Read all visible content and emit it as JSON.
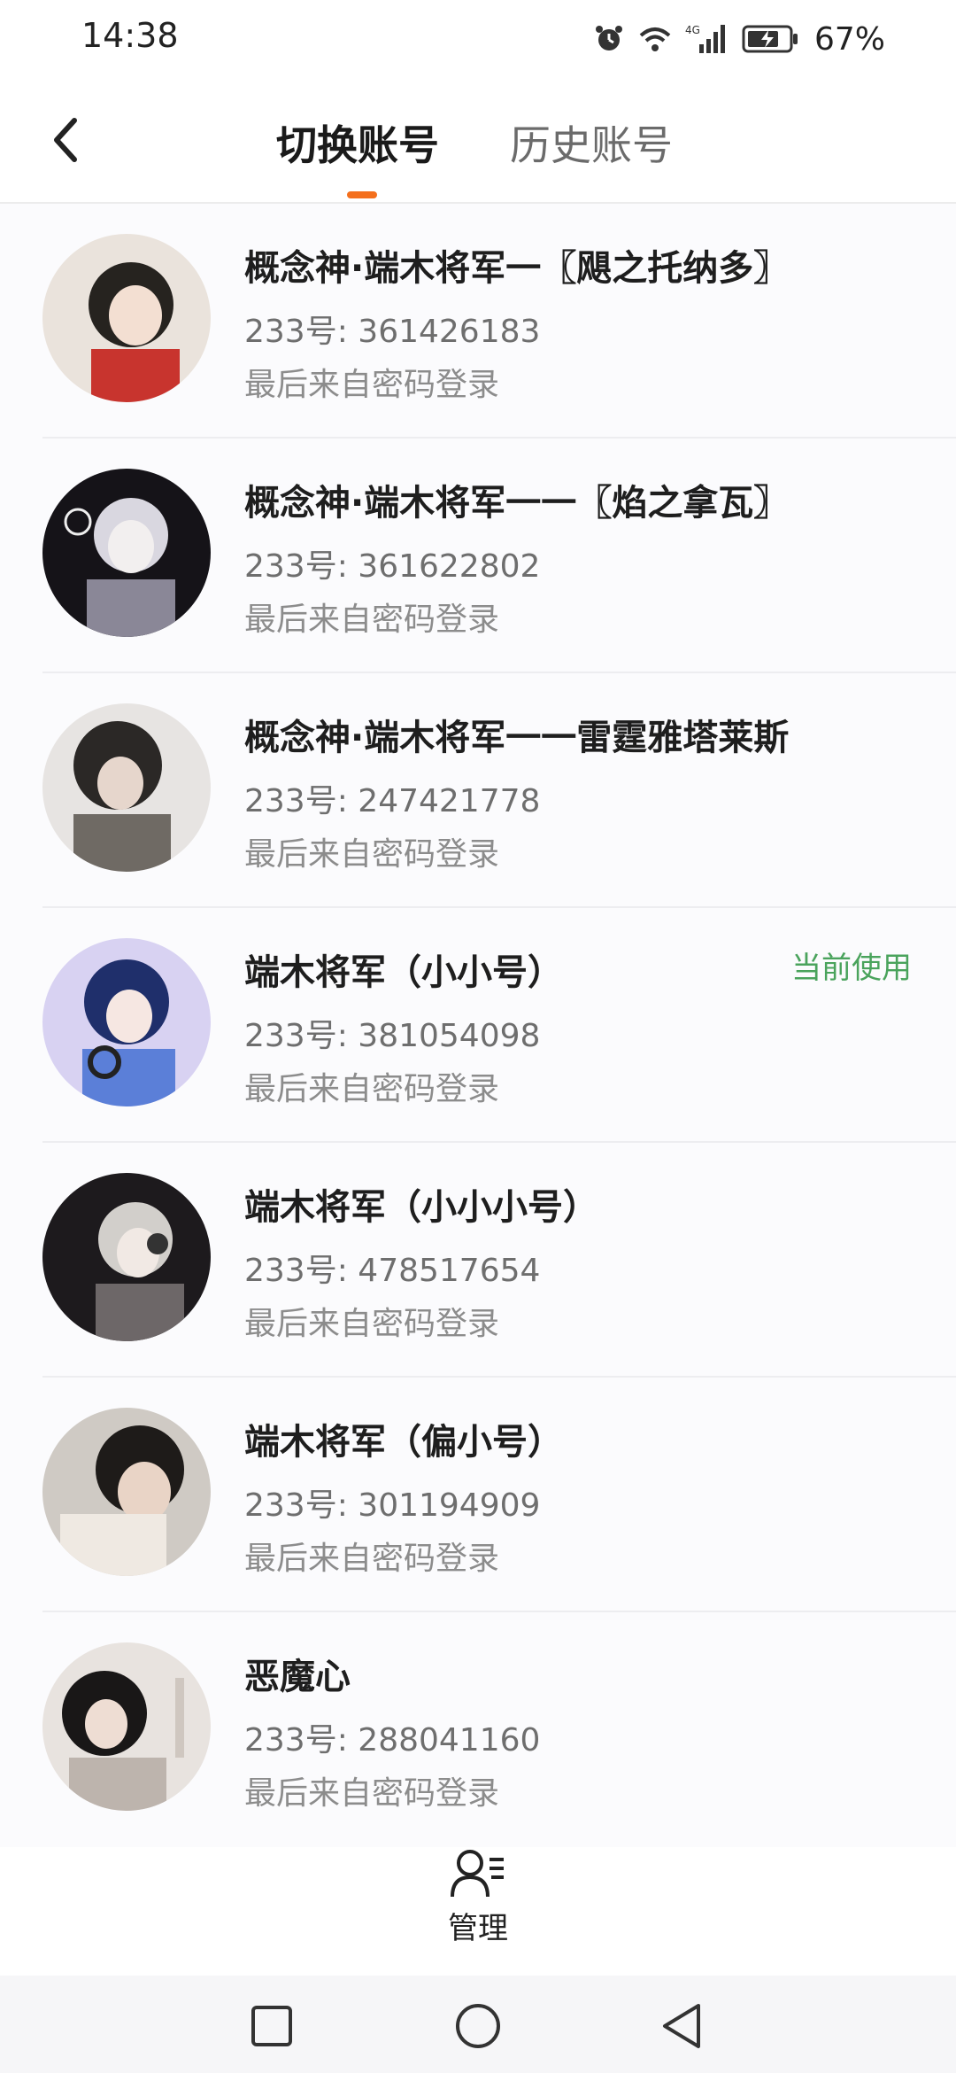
{
  "status_bar": {
    "time": "14:38",
    "battery": "67%",
    "network": "4G",
    "icons": [
      "alarm-icon",
      "wifi-icon",
      "signal-icon",
      "battery-icon"
    ]
  },
  "header": {
    "back_icon": "back-arrow-icon",
    "tabs": [
      {
        "label": "切换账号",
        "active": true
      },
      {
        "label": "历史账号",
        "active": false
      }
    ],
    "accent_color": "#f46f1c"
  },
  "accounts": [
    {
      "name": "概念神·端木将军一〖飓之托纳多〗",
      "id_line": "233号: 361426183",
      "login": "最后来自密码登录",
      "current": false,
      "avatar_colors": [
        "#eae3dc",
        "#26231f",
        "#c8342e"
      ]
    },
    {
      "name": "概念神·端木将军一一〖焰之拿瓦〗",
      "id_line": "233号: 361622802",
      "login": "最后来自密码登录",
      "current": false,
      "avatar_colors": [
        "#151318",
        "#d9d7e0",
        "#8a8797"
      ]
    },
    {
      "name": "概念神·端木将军一一雷霆雅塔莱斯",
      "id_line": "233号: 247421778",
      "login": "最后来自密码登录",
      "current": false,
      "avatar_colors": [
        "#e7e4e2",
        "#2b2826",
        "#6f6a64"
      ]
    },
    {
      "name": "端木将军（小小号）",
      "id_line": "233号: 381054098",
      "login": "最后来自密码登录",
      "current": true,
      "badge": "当前使用",
      "avatar_colors": [
        "#d8d2f2",
        "#1f2f6b",
        "#5b7fd8"
      ]
    },
    {
      "name": "端木将军（小小小号）",
      "id_line": "233号: 478517654",
      "login": "最后来自密码登录",
      "current": false,
      "avatar_colors": [
        "#1d1a1d",
        "#d2cfcb",
        "#6d6768"
      ]
    },
    {
      "name": "端木将军（偏小号）",
      "id_line": "233号: 301194909",
      "login": "最后来自密码登录",
      "current": false,
      "avatar_colors": [
        "#cfcac4",
        "#1e1b19",
        "#efe9e2"
      ]
    },
    {
      "name": "恶魔心",
      "id_line": "233号: 288041160",
      "login": "最后来自密码登录",
      "current": false,
      "avatar_colors": [
        "#e8e3df",
        "#191717",
        "#bdb4ad"
      ]
    }
  ],
  "badge_color": "#4aa35c",
  "manage": {
    "label": "管理",
    "icon": "manage-users-icon"
  },
  "nav_bar": {
    "icons": [
      "recents-square-icon",
      "home-circle-icon",
      "back-triangle-icon"
    ]
  }
}
